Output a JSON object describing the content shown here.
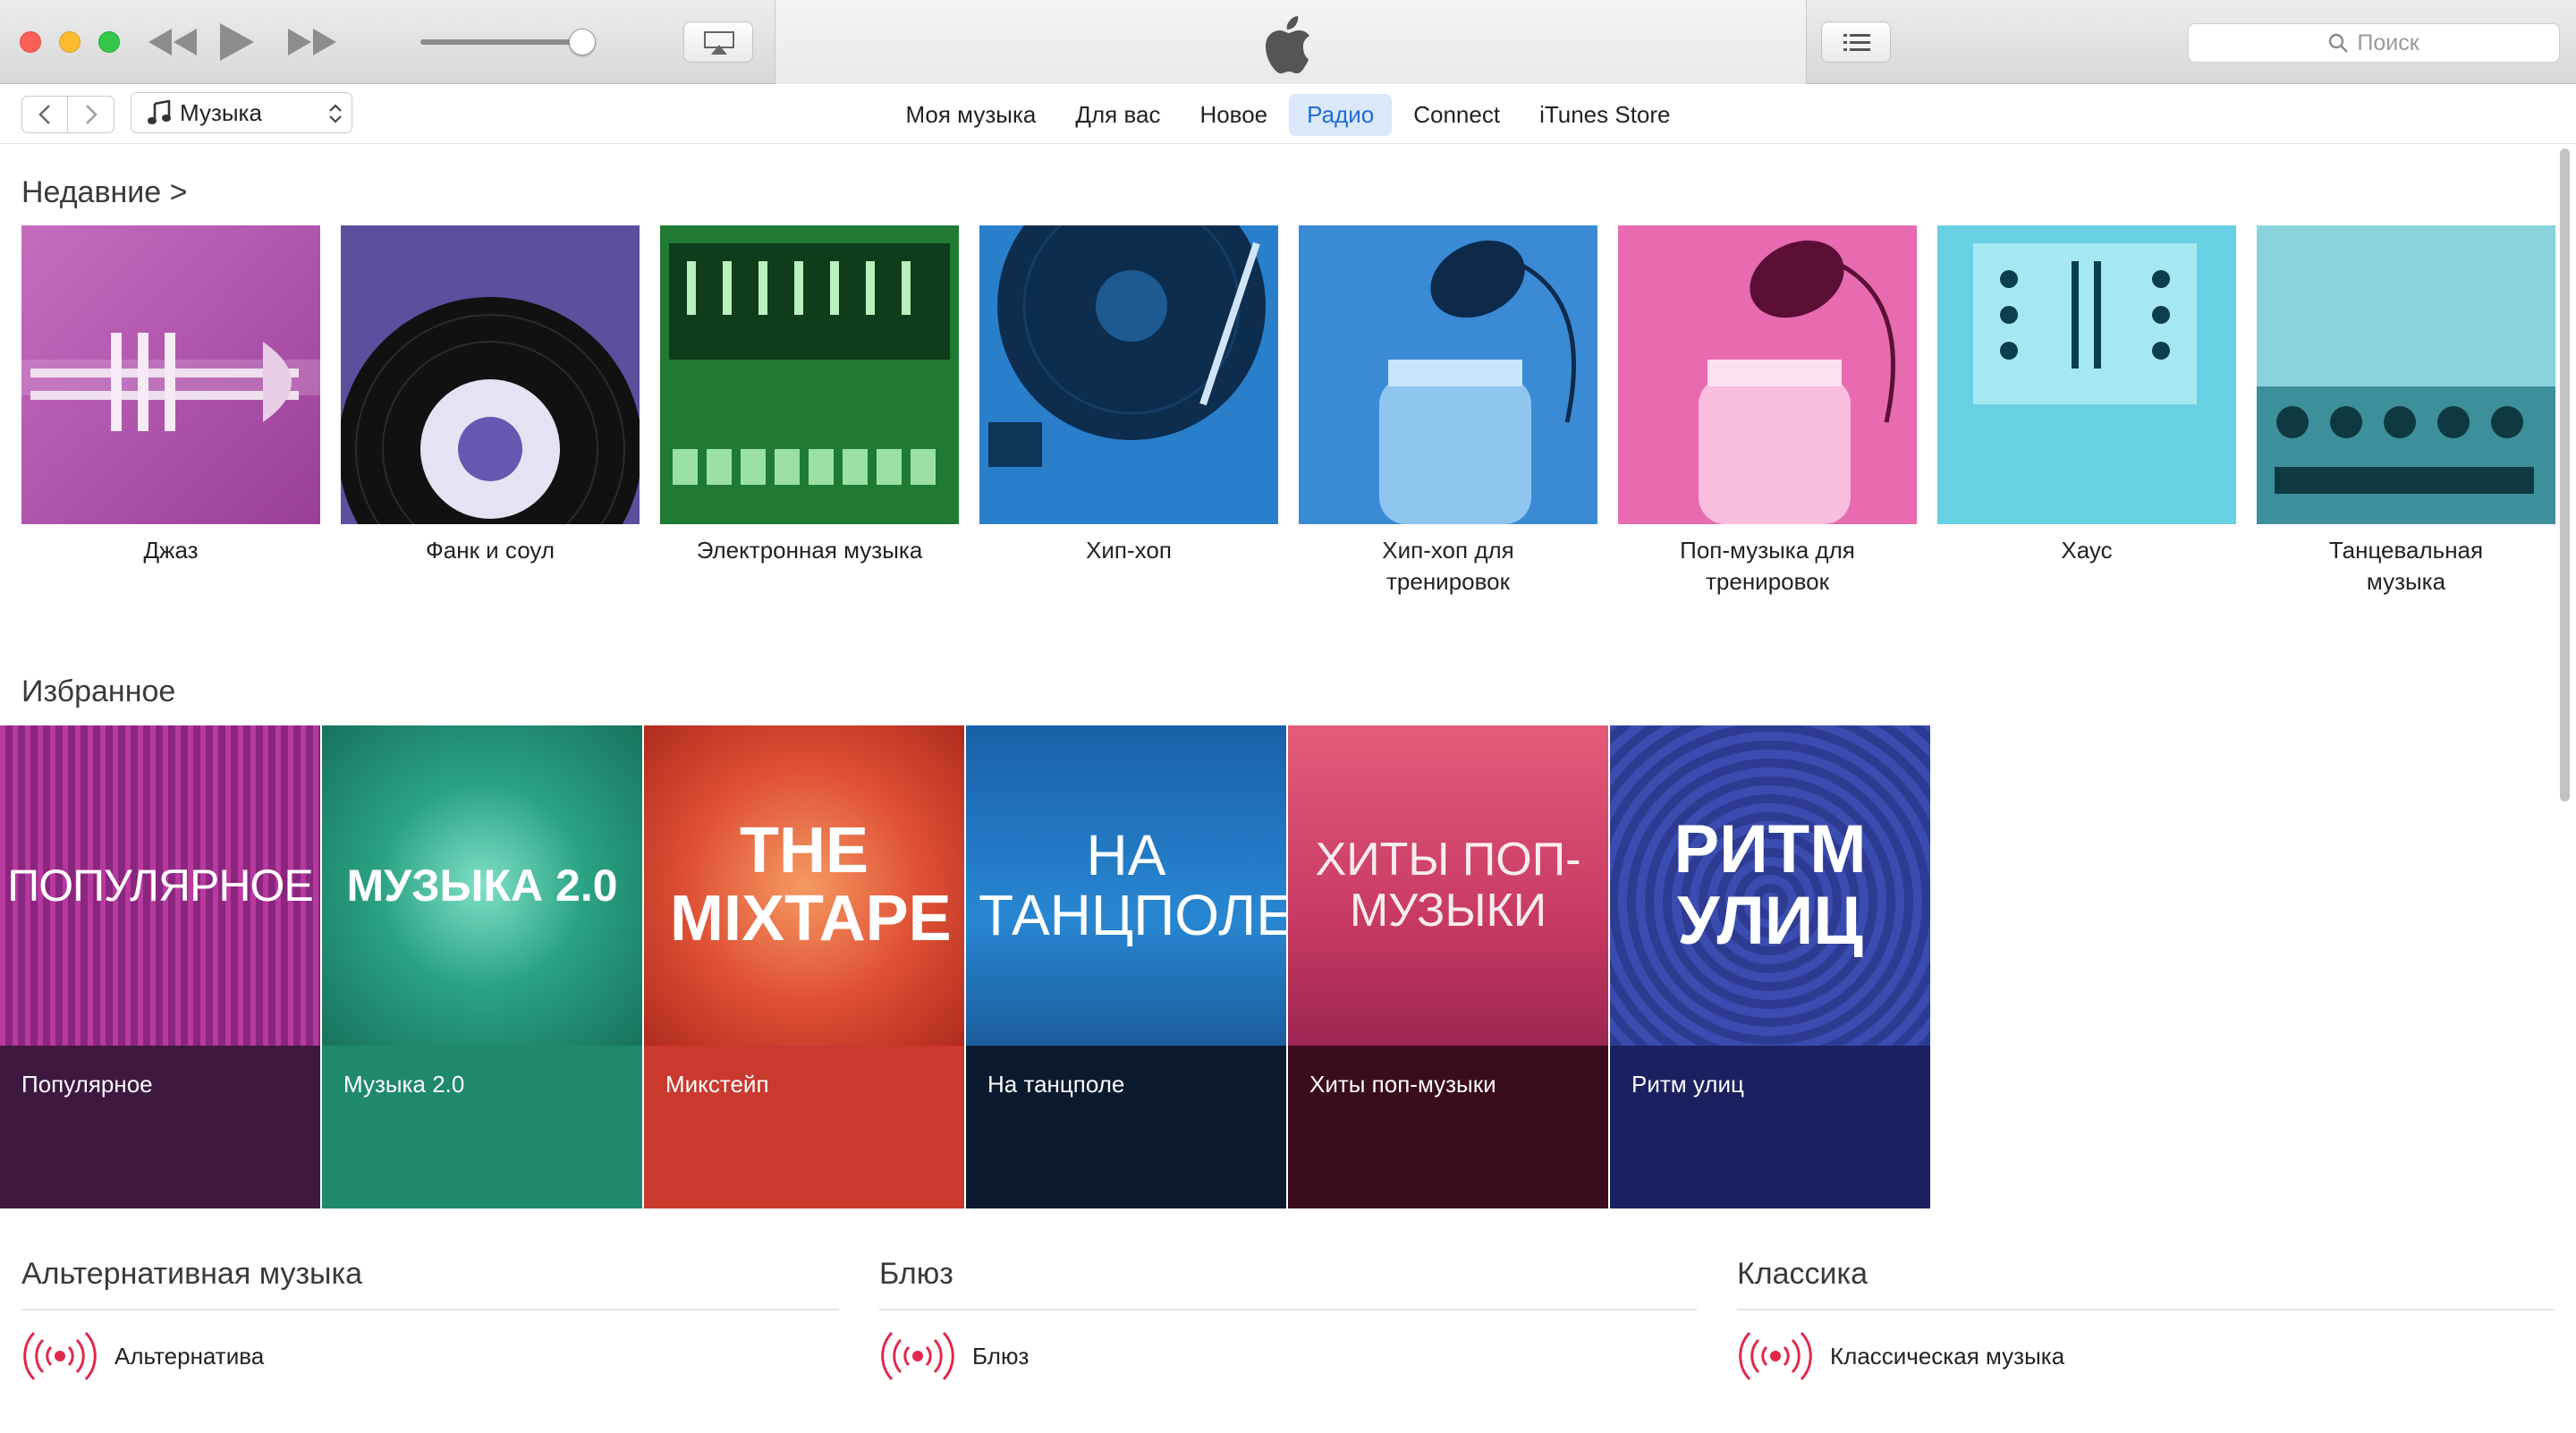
{
  "window": {
    "search_placeholder": "Поиск"
  },
  "navbar": {
    "library_label": "Музыка",
    "tabs": [
      "Моя музыка",
      "Для вас",
      "Новое",
      "Радио",
      "Connect",
      "iTunes Store"
    ],
    "active_tab": "Радио"
  },
  "recent": {
    "title": "Недавние >",
    "items": [
      {
        "label": "Джаз",
        "art_color": "#b14fb0"
      },
      {
        "label": "Фанк и соул",
        "art_color": "#5a4d9c"
      },
      {
        "label": "Электронная музыка",
        "art_color": "#1c7a34"
      },
      {
        "label": "Хип-хоп",
        "art_color": "#1f6db0"
      },
      {
        "label": "Хип-хоп для тренировок",
        "art_color": "#2a76c6"
      },
      {
        "label": "Поп-музыка для тренировок",
        "art_color": "#e35aa5"
      },
      {
        "label": "Хаус",
        "art_color": "#58c6d6"
      },
      {
        "label": "Танцевальная музыка",
        "art_color": "#4fb5c4"
      }
    ]
  },
  "featured": {
    "title": "Избранное",
    "items": [
      {
        "art_text": "ПОПУЛЯРНОЕ",
        "label": "Популярное",
        "art_color": "#9b2f8e",
        "label_bg": "#3d1841"
      },
      {
        "art_text": "МУЗЫКА 2.0",
        "label": "Музыка 2.0",
        "art_color": "#239578",
        "label_bg": "#1f8a6b"
      },
      {
        "art_text": "THE MIXTAPE",
        "label": "Микстейп",
        "art_color": "#d54a2f",
        "label_bg": "#c9392e"
      },
      {
        "art_text": "НА ТАНЦПОЛЕ",
        "label": "На танцполе",
        "art_color": "#1d6fb8",
        "label_bg": "#0b1a2e"
      },
      {
        "art_text": "ХИТЫ ПОП-МУЗЫКИ",
        "label": "Хиты поп-музыки",
        "art_color": "#c83a64",
        "label_bg": "#3b0b1e"
      },
      {
        "art_text": "РИТМ УЛИЦ",
        "label": "Ритм улиц",
        "art_color": "#3848a8",
        "label_bg": "#1b2060"
      }
    ]
  },
  "genres": [
    {
      "title": "Альтернативная музыка",
      "station": "Альтернатива"
    },
    {
      "title": "Блюз",
      "station": "Блюз"
    },
    {
      "title": "Классика",
      "station": "Классическая музыка"
    }
  ],
  "colors": {
    "accent": "#1e6bd6",
    "radio_icon": "#e0294a"
  }
}
